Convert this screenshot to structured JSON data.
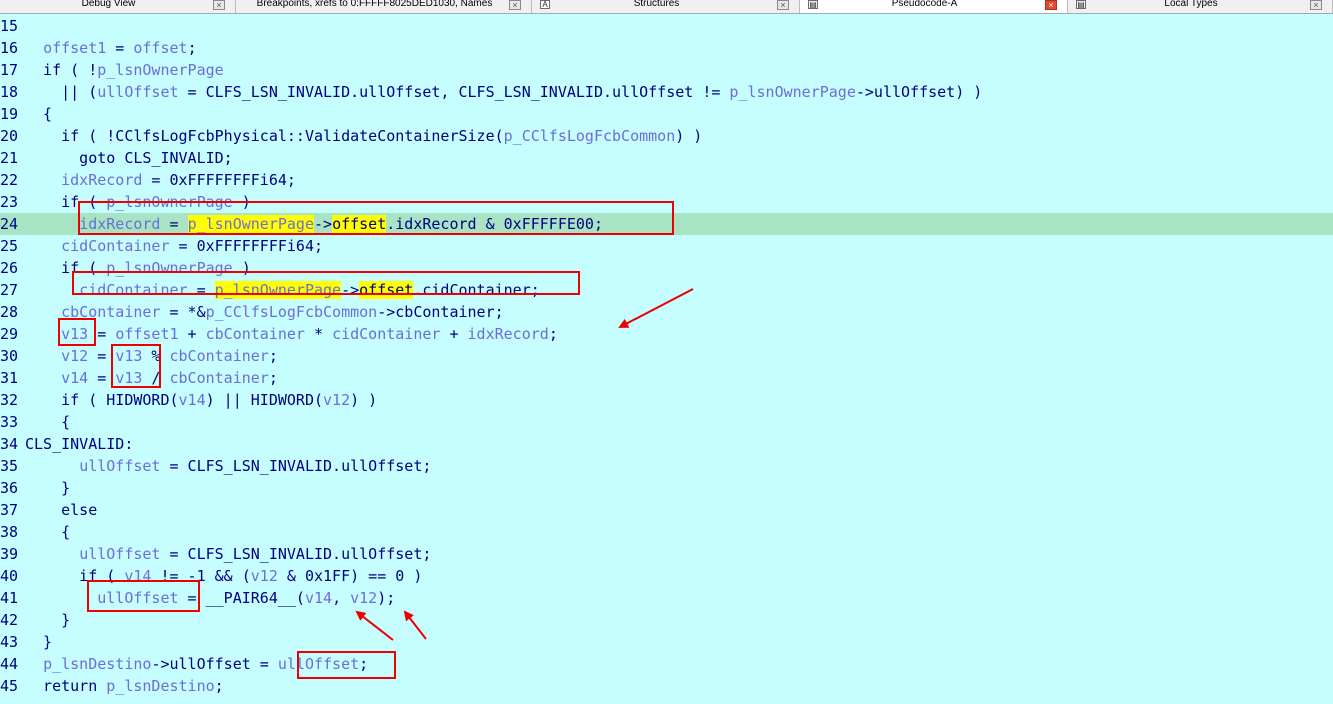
{
  "tabs": [
    {
      "label": "Debug View",
      "active": false
    },
    {
      "label": "Breakpoints, xrefs to 0:FFFFF8025DED1030, Names",
      "active": false
    },
    {
      "label": "Structures",
      "active": false,
      "icon_text": "A"
    },
    {
      "label": "Pseudocode-A",
      "active": true,
      "icon_text": "▤"
    },
    {
      "label": "Local Types",
      "active": false,
      "icon_text": "▤"
    }
  ],
  "icons": {
    "tab_close": "close-icon",
    "tab_view": "view-icon"
  },
  "colors": {
    "background": "#c6fdff",
    "code_text": "#000080",
    "variable_text": "#6d6dd7",
    "current_line": "#a8e4c4",
    "highlight": "#ffff00",
    "annotation": "#ee0000"
  },
  "code": {
    "highlighted_line": 24,
    "lines": [
      {
        "n": "15",
        "segs": [
          {
            "t": ""
          }
        ]
      },
      {
        "n": "16",
        "segs": [
          {
            "t": "  "
          },
          {
            "t": "offset1",
            "c": "v"
          },
          {
            "t": " = "
          },
          {
            "t": "offset",
            "c": "v"
          },
          {
            "t": ";"
          }
        ]
      },
      {
        "n": "17",
        "segs": [
          {
            "t": "  if ( !"
          },
          {
            "t": "p_lsnOwnerPage",
            "c": "v"
          }
        ]
      },
      {
        "n": "18",
        "segs": [
          {
            "t": "    || ("
          },
          {
            "t": "ullOffset",
            "c": "v"
          },
          {
            "t": " = CLFS_LSN_INVALID.ullOffset, CLFS_LSN_INVALID.ullOffset != "
          },
          {
            "t": "p_lsnOwnerPage",
            "c": "v"
          },
          {
            "t": "->ullOffset) )"
          }
        ]
      },
      {
        "n": "19",
        "segs": [
          {
            "t": "  {"
          }
        ]
      },
      {
        "n": "20",
        "segs": [
          {
            "t": "    if ( !CClfsLogFcbPhysical::ValidateContainerSize("
          },
          {
            "t": "p_CClfsLogFcbCommon",
            "c": "v"
          },
          {
            "t": ") )"
          }
        ]
      },
      {
        "n": "21",
        "segs": [
          {
            "t": "      goto CLS_INVALID;"
          }
        ]
      },
      {
        "n": "22",
        "segs": [
          {
            "t": "    "
          },
          {
            "t": "idxRecord",
            "c": "v"
          },
          {
            "t": " = 0xFFFFFFFFi64;"
          }
        ]
      },
      {
        "n": "23",
        "segs": [
          {
            "t": "    if ( "
          },
          {
            "t": "p_lsnOwnerPage",
            "c": "v"
          },
          {
            "t": " )"
          }
        ]
      },
      {
        "n": "24",
        "segs": [
          {
            "t": "      "
          },
          {
            "t": "idxRecord",
            "c": "v"
          },
          {
            "t": " = "
          },
          {
            "t": "p_lsnOwnerPage",
            "c": "v yl"
          },
          {
            "t": "->"
          },
          {
            "t": "offset",
            "c": "yl"
          },
          {
            "t": ".idxRecord & 0xFFFFFE00;"
          }
        ]
      },
      {
        "n": "25",
        "segs": [
          {
            "t": "    "
          },
          {
            "t": "cidContainer",
            "c": "v"
          },
          {
            "t": " = 0xFFFFFFFFi64;"
          }
        ]
      },
      {
        "n": "26",
        "segs": [
          {
            "t": "    if ( "
          },
          {
            "t": "p_lsnOwnerPage",
            "c": "v"
          },
          {
            "t": " )"
          }
        ]
      },
      {
        "n": "27",
        "segs": [
          {
            "t": "      "
          },
          {
            "t": "cidContainer",
            "c": "v"
          },
          {
            "t": " = "
          },
          {
            "t": "p_lsnOwnerPage",
            "c": "v yl"
          },
          {
            "t": "->"
          },
          {
            "t": "offset",
            "c": "yl"
          },
          {
            "t": ".cidContainer;"
          }
        ]
      },
      {
        "n": "28",
        "segs": [
          {
            "t": "    "
          },
          {
            "t": "cbContainer",
            "c": "v"
          },
          {
            "t": " = *&"
          },
          {
            "t": "p_CClfsLogFcbCommon",
            "c": "v"
          },
          {
            "t": "->cbContainer;"
          }
        ]
      },
      {
        "n": "29",
        "segs": [
          {
            "t": "    "
          },
          {
            "t": "v13",
            "c": "v"
          },
          {
            "t": " = "
          },
          {
            "t": "offset1",
            "c": "v"
          },
          {
            "t": " + "
          },
          {
            "t": "cbContainer",
            "c": "v"
          },
          {
            "t": " * "
          },
          {
            "t": "cidContainer",
            "c": "v"
          },
          {
            "t": " + "
          },
          {
            "t": "idxRecord",
            "c": "v"
          },
          {
            "t": ";"
          }
        ]
      },
      {
        "n": "30",
        "segs": [
          {
            "t": "    "
          },
          {
            "t": "v12",
            "c": "v"
          },
          {
            "t": " = "
          },
          {
            "t": "v13",
            "c": "v"
          },
          {
            "t": " % "
          },
          {
            "t": "cbContainer",
            "c": "v"
          },
          {
            "t": ";"
          }
        ]
      },
      {
        "n": "31",
        "segs": [
          {
            "t": "    "
          },
          {
            "t": "v14",
            "c": "v"
          },
          {
            "t": " = "
          },
          {
            "t": "v13",
            "c": "v"
          },
          {
            "t": " / "
          },
          {
            "t": "cbContainer",
            "c": "v"
          },
          {
            "t": ";"
          }
        ]
      },
      {
        "n": "32",
        "segs": [
          {
            "t": "    if ( HIDWORD("
          },
          {
            "t": "v14",
            "c": "v"
          },
          {
            "t": ") || HIDWORD("
          },
          {
            "t": "v12",
            "c": "v"
          },
          {
            "t": ") )"
          }
        ]
      },
      {
        "n": "33",
        "segs": [
          {
            "t": "    {"
          }
        ]
      },
      {
        "n": "34",
        "segs": [
          {
            "t": "CLS_INVALID:"
          }
        ]
      },
      {
        "n": "35",
        "segs": [
          {
            "t": "      "
          },
          {
            "t": "ullOffset",
            "c": "v"
          },
          {
            "t": " = CLFS_LSN_INVALID.ullOffset;"
          }
        ]
      },
      {
        "n": "36",
        "segs": [
          {
            "t": "    }"
          }
        ]
      },
      {
        "n": "37",
        "segs": [
          {
            "t": "    else"
          }
        ]
      },
      {
        "n": "38",
        "segs": [
          {
            "t": "    {"
          }
        ]
      },
      {
        "n": "39",
        "segs": [
          {
            "t": "      "
          },
          {
            "t": "ullOffset",
            "c": "v"
          },
          {
            "t": " = CLFS_LSN_INVALID.ullOffset;"
          }
        ]
      },
      {
        "n": "40",
        "segs": [
          {
            "t": "      if ( "
          },
          {
            "t": "v14",
            "c": "v"
          },
          {
            "t": " != -1 && ("
          },
          {
            "t": "v12",
            "c": "v"
          },
          {
            "t": " & 0x1FF) == 0 )"
          }
        ]
      },
      {
        "n": "41",
        "segs": [
          {
            "t": "        "
          },
          {
            "t": "ullOffset",
            "c": "v"
          },
          {
            "t": " = __PAIR64__("
          },
          {
            "t": "v14",
            "c": "v"
          },
          {
            "t": ", "
          },
          {
            "t": "v12",
            "c": "v"
          },
          {
            "t": ");"
          }
        ]
      },
      {
        "n": "42",
        "segs": [
          {
            "t": "    }"
          }
        ]
      },
      {
        "n": "43",
        "segs": [
          {
            "t": "  }"
          }
        ]
      },
      {
        "n": "44",
        "segs": [
          {
            "t": "  "
          },
          {
            "t": "p_lsnDestino",
            "c": "v"
          },
          {
            "t": "->ullOffset = "
          },
          {
            "t": "ullOffset",
            "c": "v"
          },
          {
            "t": ";"
          }
        ]
      },
      {
        "n": "45",
        "segs": [
          {
            "t": "  return "
          },
          {
            "t": "p_lsnDestino",
            "c": "v"
          },
          {
            "t": ";"
          }
        ]
      }
    ]
  }
}
